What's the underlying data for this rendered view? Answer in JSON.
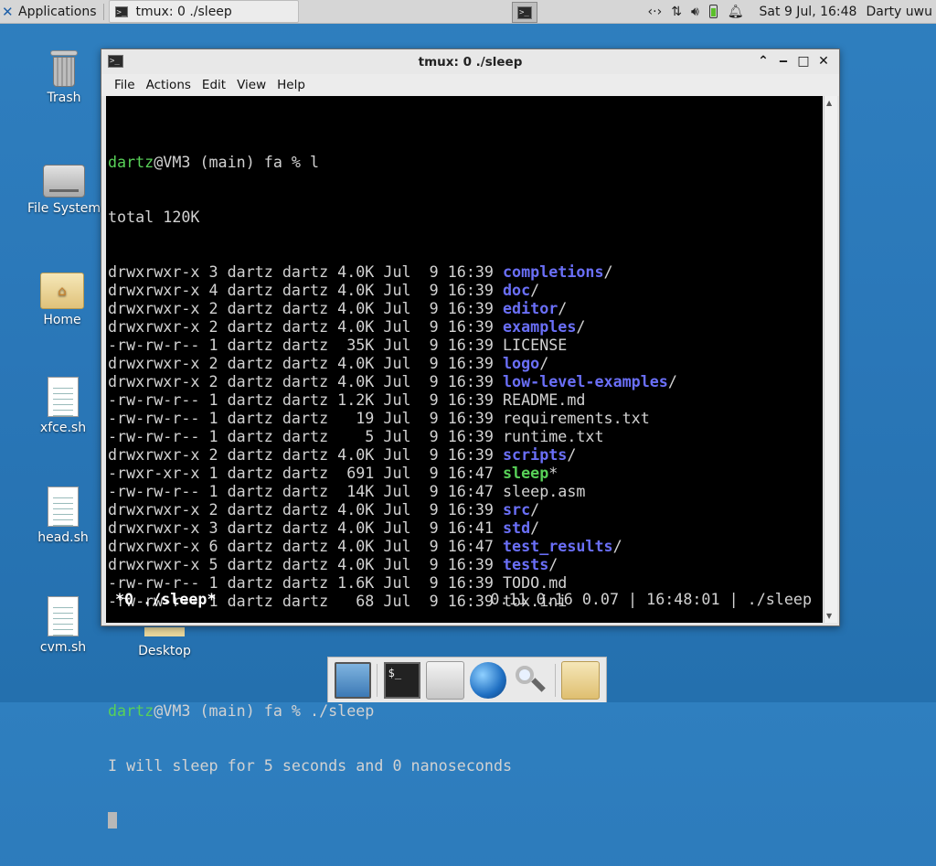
{
  "panel": {
    "applications_label": "Applications",
    "task_title": "tmux: 0 ./sleep",
    "clock": "Sat  9 Jul, 16:48",
    "user": "Darty uwu",
    "tray_icons": [
      "network-icon",
      "transfer-icon",
      "volume-icon",
      "battery-icon",
      "bell-icon"
    ]
  },
  "desktop": {
    "icons": [
      {
        "label": "Trash"
      },
      {
        "label": "File System"
      },
      {
        "label": "Home"
      },
      {
        "label": "xfce.sh"
      },
      {
        "label": "head.sh"
      },
      {
        "label": "cvm.sh"
      },
      {
        "label": "Desktop"
      }
    ]
  },
  "window": {
    "title": "tmux: 0 ./sleep",
    "menu": [
      "File",
      "Actions",
      "Edit",
      "View",
      "Help"
    ]
  },
  "terminal": {
    "prompt_user": "dartz",
    "prompt_rest": "@VM3 (main) fa % ",
    "cmd1": "l",
    "total": "total 120K",
    "listing": [
      {
        "meta": "drwxrwxr-x 3 dartz dartz 4.0K Jul  9 16:39 ",
        "name": "completions",
        "suffix": "/",
        "kind": "dir"
      },
      {
        "meta": "drwxrwxr-x 4 dartz dartz 4.0K Jul  9 16:39 ",
        "name": "doc",
        "suffix": "/",
        "kind": "dir"
      },
      {
        "meta": "drwxrwxr-x 2 dartz dartz 4.0K Jul  9 16:39 ",
        "name": "editor",
        "suffix": "/",
        "kind": "dir"
      },
      {
        "meta": "drwxrwxr-x 2 dartz dartz 4.0K Jul  9 16:39 ",
        "name": "examples",
        "suffix": "/",
        "kind": "dir"
      },
      {
        "meta": "-rw-rw-r-- 1 dartz dartz  35K Jul  9 16:39 ",
        "name": "LICENSE",
        "suffix": "",
        "kind": "file"
      },
      {
        "meta": "drwxrwxr-x 2 dartz dartz 4.0K Jul  9 16:39 ",
        "name": "logo",
        "suffix": "/",
        "kind": "dir"
      },
      {
        "meta": "drwxrwxr-x 2 dartz dartz 4.0K Jul  9 16:39 ",
        "name": "low-level-examples",
        "suffix": "/",
        "kind": "dir"
      },
      {
        "meta": "-rw-rw-r-- 1 dartz dartz 1.2K Jul  9 16:39 ",
        "name": "README.md",
        "suffix": "",
        "kind": "file"
      },
      {
        "meta": "-rw-rw-r-- 1 dartz dartz   19 Jul  9 16:39 ",
        "name": "requirements.txt",
        "suffix": "",
        "kind": "file"
      },
      {
        "meta": "-rw-rw-r-- 1 dartz dartz    5 Jul  9 16:39 ",
        "name": "runtime.txt",
        "suffix": "",
        "kind": "file"
      },
      {
        "meta": "drwxrwxr-x 2 dartz dartz 4.0K Jul  9 16:39 ",
        "name": "scripts",
        "suffix": "/",
        "kind": "dir"
      },
      {
        "meta": "-rwxr-xr-x 1 dartz dartz  691 Jul  9 16:47 ",
        "name": "sleep",
        "suffix": "*",
        "kind": "exe"
      },
      {
        "meta": "-rw-rw-r-- 1 dartz dartz  14K Jul  9 16:47 ",
        "name": "sleep.asm",
        "suffix": "",
        "kind": "file"
      },
      {
        "meta": "drwxrwxr-x 2 dartz dartz 4.0K Jul  9 16:39 ",
        "name": "src",
        "suffix": "/",
        "kind": "dir"
      },
      {
        "meta": "drwxrwxr-x 3 dartz dartz 4.0K Jul  9 16:41 ",
        "name": "std",
        "suffix": "/",
        "kind": "dir"
      },
      {
        "meta": "drwxrwxr-x 6 dartz dartz 4.0K Jul  9 16:47 ",
        "name": "test_results",
        "suffix": "/",
        "kind": "dir"
      },
      {
        "meta": "drwxrwxr-x 5 dartz dartz 4.0K Jul  9 16:39 ",
        "name": "tests",
        "suffix": "/",
        "kind": "dir"
      },
      {
        "meta": "-rw-rw-r-- 1 dartz dartz 1.6K Jul  9 16:39 ",
        "name": "TODO.md",
        "suffix": "",
        "kind": "file"
      },
      {
        "meta": "-rw-rw-r-- 1 dartz dartz   68 Jul  9 16:39 ",
        "name": "tox.ini",
        "suffix": "",
        "kind": "file"
      }
    ],
    "cmd2": "./sleep",
    "output": "I will sleep for 5 seconds and 0 nanoseconds",
    "status_left": "*0 ./sleep*",
    "status_right": "0.11 0.16 0.07 | 16:48:01 | ./sleep"
  },
  "dock": {
    "items": [
      "show-desktop-icon",
      "terminal-icon",
      "home-folder-icon",
      "web-browser-icon",
      "search-icon",
      "folder-icon"
    ]
  },
  "colors": {
    "desktop_bg": "#2a77b8",
    "prompt_green": "#58d158",
    "dir_blue": "#6a6ff7"
  }
}
